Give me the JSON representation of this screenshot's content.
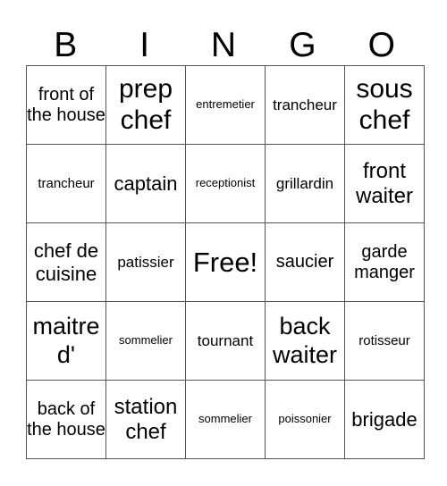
{
  "header": {
    "letters": [
      "B",
      "I",
      "N",
      "G",
      "O"
    ]
  },
  "rows": [
    [
      "front of the house",
      "prep chef",
      "entremetier",
      "trancheur",
      "sous chef"
    ],
    [
      "trancheur",
      "captain",
      "receptionist",
      "grillardin",
      "front waiter"
    ],
    [
      "chef de cuisine",
      "patissier",
      "Free!",
      "saucier",
      "garde manger"
    ],
    [
      "maitre d'",
      "sommelier",
      "tournant",
      "back waiter",
      "rotisseur"
    ],
    [
      "back of the house",
      "station chef",
      "sommelier",
      "poissonier",
      "brigade"
    ]
  ]
}
